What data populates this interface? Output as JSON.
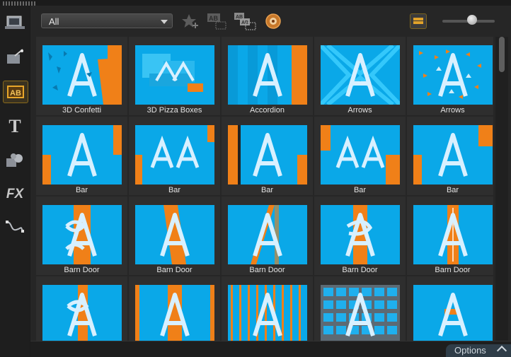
{
  "filter": {
    "selected": "All"
  },
  "icons": {
    "toolbar": [
      "add-to-favorites-icon",
      "apply-to-all-icon",
      "apply-random-icon",
      "get-more-icon"
    ],
    "sidebar": [
      "media-icon",
      "instant-project-icon",
      "transition-icon",
      "title-icon",
      "graphics-icon",
      "fx-icon",
      "path-icon"
    ]
  },
  "sidebar": {
    "title_glyph": "T",
    "fx_label": "FX"
  },
  "colors": {
    "thumb_bg": "#0aa8e8",
    "accent": "#f08018",
    "letter": "#d8f0ff"
  },
  "transitions": [
    {
      "name": "3D Confetti",
      "style": "confetti"
    },
    {
      "name": "3D Pizza Boxes",
      "style": "pizza"
    },
    {
      "name": "Accordion",
      "style": "accordion"
    },
    {
      "name": "Arrows",
      "style": "arrows1"
    },
    {
      "name": "Arrows",
      "style": "arrows2"
    },
    {
      "name": "Bar",
      "style": "bar1"
    },
    {
      "name": "Bar",
      "style": "bar2"
    },
    {
      "name": "Bar",
      "style": "bar3"
    },
    {
      "name": "Bar",
      "style": "bar4"
    },
    {
      "name": "Bar",
      "style": "bar5"
    },
    {
      "name": "Barn Door",
      "style": "barn1"
    },
    {
      "name": "Barn Door",
      "style": "barn2"
    },
    {
      "name": "Barn Door",
      "style": "barn3"
    },
    {
      "name": "Barn Door",
      "style": "barn4"
    },
    {
      "name": "Barn Door",
      "style": "barn5"
    },
    {
      "name": "",
      "style": "next1"
    },
    {
      "name": "",
      "style": "next2"
    },
    {
      "name": "",
      "style": "next3"
    },
    {
      "name": "",
      "style": "next4"
    },
    {
      "name": "",
      "style": "next5"
    }
  ],
  "footer": {
    "options_label": "Options"
  }
}
